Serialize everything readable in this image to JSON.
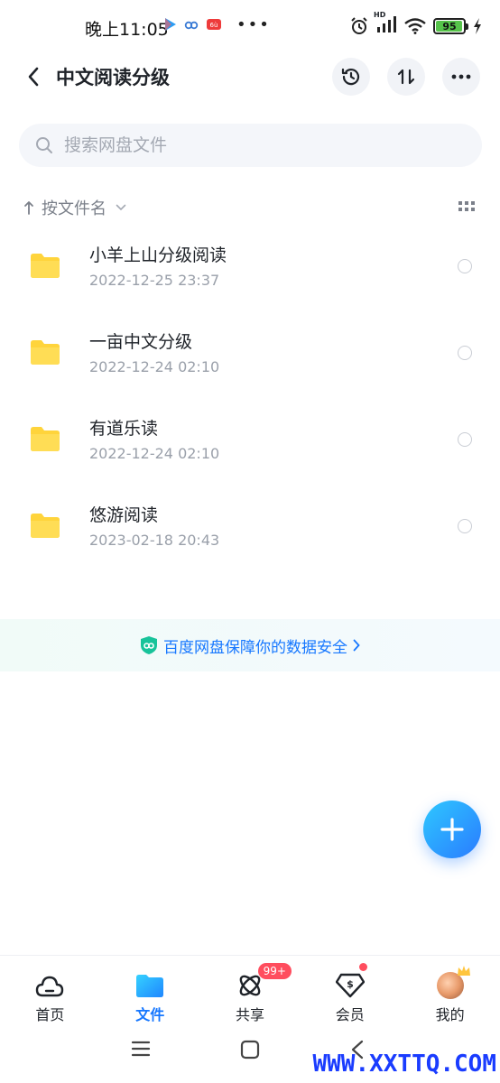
{
  "status_bar": {
    "time": "晚上11:05",
    "battery_level": "95",
    "network_label": "HD",
    "more_dots": "•••"
  },
  "header": {
    "title": "中文阅读分级"
  },
  "search": {
    "placeholder": "搜索网盘文件"
  },
  "sort": {
    "label": "按文件名"
  },
  "files": [
    {
      "name": "小羊上山分级阅读",
      "date": "2022-12-25  23:37"
    },
    {
      "name": "一亩中文分级",
      "date": "2022-12-24  02:10"
    },
    {
      "name": "有道乐读",
      "date": "2022-12-24  02:10"
    },
    {
      "name": "悠游阅读",
      "date": "2023-02-18  20:43"
    }
  ],
  "security_banner": {
    "text": "百度网盘保障你的数据安全"
  },
  "bottom_nav": {
    "items": [
      {
        "label": "首页"
      },
      {
        "label": "文件"
      },
      {
        "label": "共享",
        "badge": "99+"
      },
      {
        "label": "会员"
      },
      {
        "label": "我的"
      }
    ]
  },
  "watermark": "WWW.XXTTQ.COM",
  "colors": {
    "accent": "#1677ff",
    "folder": "#ffd43b",
    "badge": "#ff4d5e"
  }
}
